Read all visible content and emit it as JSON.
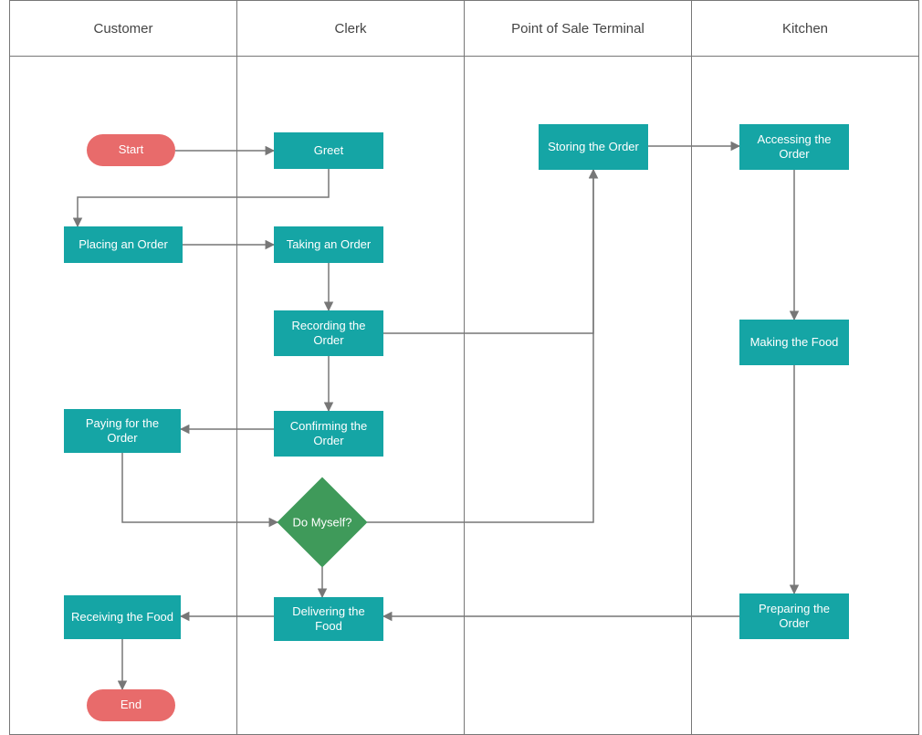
{
  "lanes": {
    "customer": "Customer",
    "clerk": "Clerk",
    "pos": "Point of Sale Terminal",
    "kitchen": "Kitchen"
  },
  "nodes": {
    "start": "Start",
    "greet": "Greet",
    "placing_order": "Placing an Order",
    "taking_order": "Taking an Order",
    "recording_order": "Recording the Order",
    "confirming_order": "Confirming the Order",
    "paying_order": "Paying for the Order",
    "do_myself": "Do Myself?",
    "delivering_food": "Delivering the Food",
    "receiving_food": "Receiving the Food",
    "end": "End",
    "storing_order": "Storing the Order",
    "accessing_order": "Accessing the Order",
    "making_food": "Making the Food",
    "preparing_order": "Preparing the Order"
  },
  "colors": {
    "process": "#15a5a5",
    "terminator": "#e86b6b",
    "decision": "#3f9a5a",
    "line": "#777777"
  },
  "chart_data": {
    "type": "swimlane-flowchart",
    "lanes": [
      "Customer",
      "Clerk",
      "Point of Sale Terminal",
      "Kitchen"
    ],
    "nodes": [
      {
        "id": "start",
        "lane": "Customer",
        "type": "terminator",
        "label": "Start"
      },
      {
        "id": "greet",
        "lane": "Clerk",
        "type": "process",
        "label": "Greet"
      },
      {
        "id": "placing_order",
        "lane": "Customer",
        "type": "process",
        "label": "Placing an Order"
      },
      {
        "id": "taking_order",
        "lane": "Clerk",
        "type": "process",
        "label": "Taking an Order"
      },
      {
        "id": "recording_order",
        "lane": "Clerk",
        "type": "process",
        "label": "Recording the Order"
      },
      {
        "id": "confirming_order",
        "lane": "Clerk",
        "type": "process",
        "label": "Confirming the Order"
      },
      {
        "id": "paying_order",
        "lane": "Customer",
        "type": "process",
        "label": "Paying for the Order"
      },
      {
        "id": "do_myself",
        "lane": "Clerk",
        "type": "decision",
        "label": "Do Myself?"
      },
      {
        "id": "delivering_food",
        "lane": "Clerk",
        "type": "process",
        "label": "Delivering the Food"
      },
      {
        "id": "receiving_food",
        "lane": "Customer",
        "type": "process",
        "label": "Receiving the Food"
      },
      {
        "id": "end",
        "lane": "Customer",
        "type": "terminator",
        "label": "End"
      },
      {
        "id": "storing_order",
        "lane": "Point of Sale Terminal",
        "type": "process",
        "label": "Storing the Order"
      },
      {
        "id": "accessing_order",
        "lane": "Kitchen",
        "type": "process",
        "label": "Accessing the Order"
      },
      {
        "id": "making_food",
        "lane": "Kitchen",
        "type": "process",
        "label": "Making the Food"
      },
      {
        "id": "preparing_order",
        "lane": "Kitchen",
        "type": "process",
        "label": "Preparing the Order"
      }
    ],
    "edges": [
      {
        "from": "start",
        "to": "greet"
      },
      {
        "from": "greet",
        "to": "placing_order"
      },
      {
        "from": "placing_order",
        "to": "taking_order"
      },
      {
        "from": "taking_order",
        "to": "recording_order"
      },
      {
        "from": "recording_order",
        "to": "confirming_order"
      },
      {
        "from": "recording_order",
        "to": "storing_order"
      },
      {
        "from": "confirming_order",
        "to": "paying_order"
      },
      {
        "from": "paying_order",
        "to": "do_myself"
      },
      {
        "from": "do_myself",
        "to": "storing_order"
      },
      {
        "from": "do_myself",
        "to": "delivering_food"
      },
      {
        "from": "delivering_food",
        "to": "receiving_food"
      },
      {
        "from": "receiving_food",
        "to": "end"
      },
      {
        "from": "storing_order",
        "to": "accessing_order"
      },
      {
        "from": "accessing_order",
        "to": "making_food"
      },
      {
        "from": "making_food",
        "to": "preparing_order"
      },
      {
        "from": "preparing_order",
        "to": "delivering_food"
      }
    ]
  }
}
